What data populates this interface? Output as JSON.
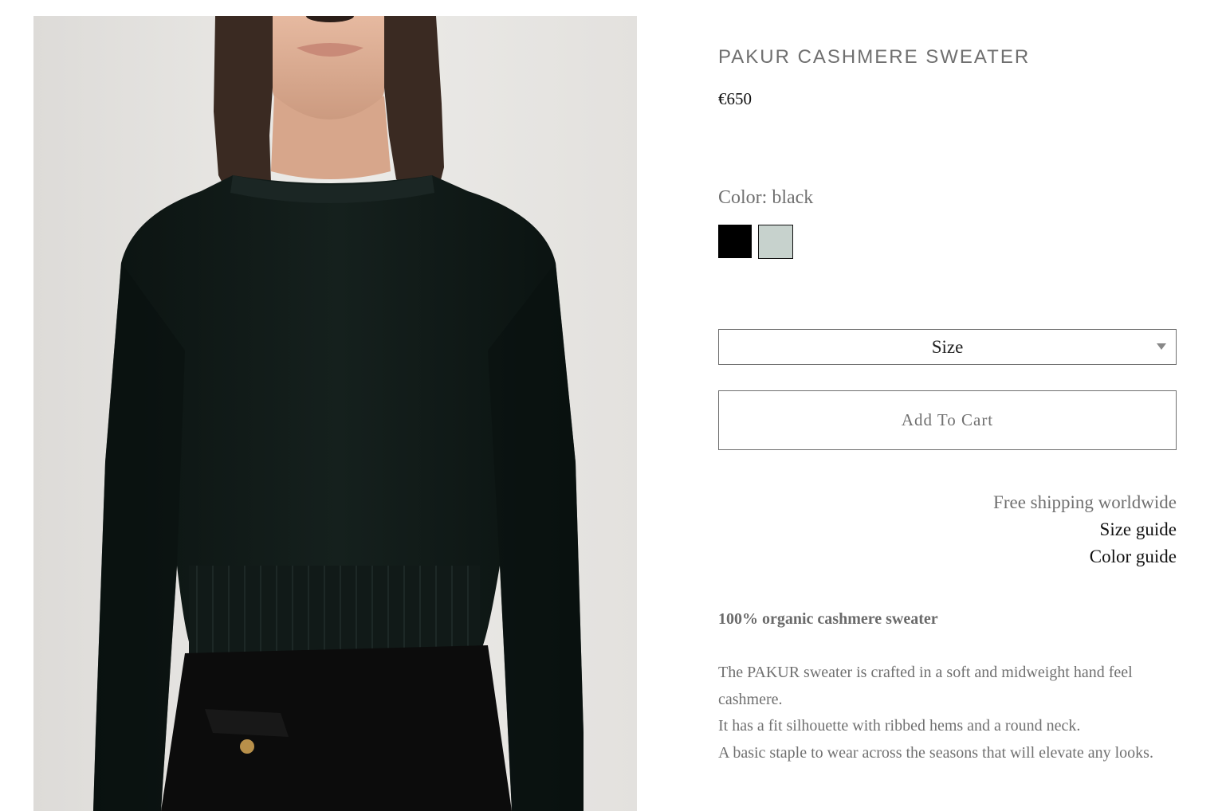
{
  "product": {
    "title": "PAKUR CASHMERE SWEATER",
    "price": "€650",
    "image_alt": "Model wearing black cashmere crew-neck sweater"
  },
  "color": {
    "label": "Color: black",
    "swatches": [
      {
        "name": "black",
        "hex": "#000000"
      },
      {
        "name": "sage",
        "hex": "#c7d2cd"
      }
    ]
  },
  "size_select": {
    "selected": "Size",
    "icon": "chevron-down-icon"
  },
  "cart": {
    "button_label": "Add To Cart"
  },
  "info_links": {
    "shipping": "Free shipping worldwide",
    "size_guide": "Size guide",
    "color_guide": "Color guide"
  },
  "description": {
    "heading": "100% organic cashmere sweater",
    "paragraphs": [
      "The PAKUR sweater is crafted in a soft and midweight hand feel cashmere.",
      "It has a fit silhouette with ribbed hems and a round neck.",
      "A basic staple to wear across the seasons that will elevate any looks."
    ]
  },
  "colors": {
    "text": "#6f6f6f",
    "accent": "#111111",
    "sweater": "#0e1614"
  }
}
